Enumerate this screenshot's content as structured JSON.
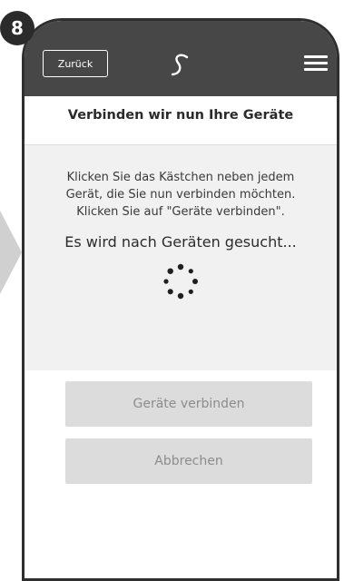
{
  "step": {
    "number": "8"
  },
  "header": {
    "back_label": "Zurück",
    "logo_icon": "brand-logo-icon",
    "menu_icon": "hamburger-menu-icon"
  },
  "page": {
    "title": "Verbinden wir nun Ihre Geräte",
    "instruction_lines": [
      "Klicken Sie das Kästchen neben jedem",
      "Gerät, die Sie nun verbinden möchten.",
      "Klicken Sie auf \"Geräte verbinden\"."
    ],
    "status": "Es wird nach Geräten gesucht...",
    "spinner_icon": "loading-spinner-icon"
  },
  "buttons": {
    "connect_label": "Geräte verbinden",
    "cancel_label": "Abbrechen"
  },
  "colors": {
    "header_bg": "#474747",
    "panel_bg": "#f1f1f1",
    "button_disabled_bg": "#dcdcdc",
    "button_disabled_text": "#8c8c8c"
  }
}
